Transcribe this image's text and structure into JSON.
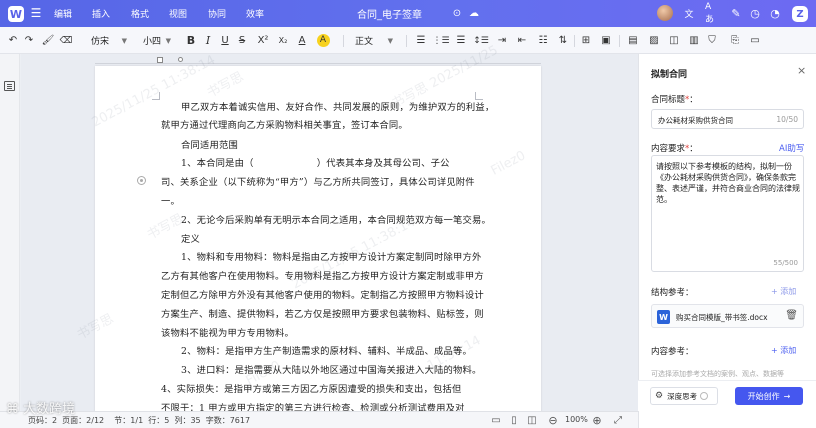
{
  "titlebar": {
    "logo_glyph": "W",
    "menu": [
      "编辑",
      "插入",
      "格式",
      "视图",
      "协同",
      "效率"
    ],
    "doc_title": "合同_电子签章",
    "right_icons": [
      "avatar",
      "translate-icon",
      "text-tool-icon",
      "edit-icon",
      "history-icon",
      "notification-icon"
    ],
    "z_label": "Z"
  },
  "toolbar": {
    "font_name": "仿宋",
    "font_size": "小四",
    "style_name": "正文",
    "buttons": [
      "undo-icon",
      "redo-icon",
      "format-painter-icon",
      "eraser-icon",
      "bold-icon",
      "italic-icon",
      "underline-icon",
      "strikethrough-icon",
      "superscript-icon",
      "font-color-icon",
      "highlight-icon",
      "list-icon",
      "numbered-list-icon",
      "align-icon",
      "line-spacing-icon",
      "indent-icon",
      "table-icon",
      "frame-icon",
      "text-box-icon",
      "image-icon",
      "shape-icon",
      "chart-icon",
      "shield-icon",
      "link-icon",
      "more-icon"
    ]
  },
  "document": {
    "lines": [
      "甲乙双方本着诚实信用、友好合作、共同发展的原则，为维护双方的利益，",
      "就甲方通过代理商向乙方采购物料相关事宜，签订本合同。",
      "合同适用范围",
      "1、本合同是由（                    ）代表其本身及其母公司、子公",
      "司、关系企业（以下统称为“甲方”）与乙方所共同签订，具体公司详见附件",
      "一。",
      "2、无论今后采购单有无明示本合同之适用，本合同规范双方每一笔交易。",
      "定义",
      "1、物料和专用物料：物料是指由乙方按甲方设计方案定制同时除甲方外",
      "乙方有其他客户在使用物料。专用物料是指乙方按甲方设计方案定制或非甲方",
      "定制但乙方除甲方外没有其他客户使用的物料。定制指乙方按照甲方物料设计",
      "方案生产、制造、提供物料，若乙方仅是按照甲方要求包装物料、贴标签，则",
      "该物料不能视为甲方专用物料。",
      "2、物料：是指甲方生产制造需求的原材料、辅料、半成品、成品等。",
      "3、进口料：是指需要从大陆以外地区通过中国海关报进入大陆的物料。",
      "4、实际损失：是指甲方或第三方因乙方原因遭受的损失和支出，包括但",
      "不限于：1 甲方或甲方指定的第三方进行检查、检测或分析测试费用及对"
    ],
    "watermarks": [
      "书写思",
      "2025/11/25 11:38:14",
      "Filez0",
      "书写思 2025/11/25",
      "11:38:14",
      "书写思",
      "2025/11/25 11:38:14",
      "Filez0"
    ]
  },
  "statusbar": {
    "text": "页码：2  页面：2/12    节：1/1  行：5  列：35  字数：7617",
    "zoom": "100%",
    "zoom_minus": "⊖",
    "zoom_plus": "⊕"
  },
  "brand_watermark": "大数跨境",
  "panel": {
    "title": "拟制合同",
    "close_glyph": "×",
    "title_label": "合同标题",
    "title_required": "*",
    "title_value": "办公耗材采购供货合同",
    "title_counter": "10/50",
    "content_label": "内容要求",
    "content_required": "*",
    "ai_help": "AI助写",
    "content_value": "请按照以下参考模板的结构，拟制一份《办公耗材采购供货合同》，确保条款完整、表述严谨，并符合商业合同的法律规范。",
    "content_counter": "55/500",
    "structure_label": "结构参考：",
    "structure_add": "+ 添加",
    "file_name": "购买合同模版_带书签.docx",
    "file_icon": "W",
    "content_ref_label": "内容参考：",
    "content_ref_add": "+ 添加",
    "content_ref_placeholder": "可选择添加参考文档的案例、观点、数据等",
    "deep_think": "深度思考",
    "start_button": "开始创作",
    "start_arrow": "→"
  }
}
